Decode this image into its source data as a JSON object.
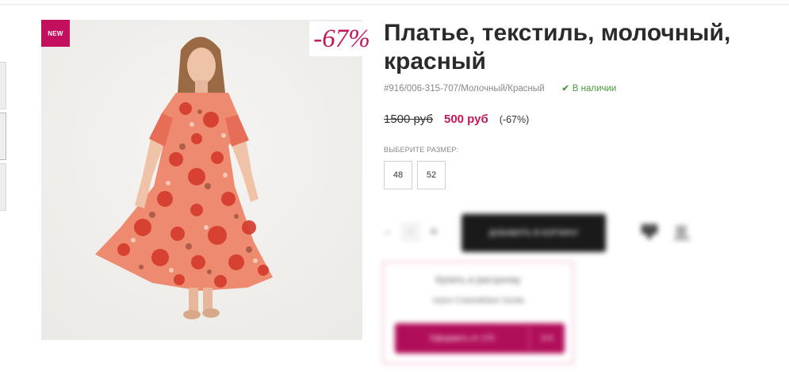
{
  "product": {
    "title": "Платье, текстиль, молочный, красный",
    "sku": "#916/006-315-707/Молочный/Красный",
    "stock_icon": "check-icon",
    "stock_label": "В наличии",
    "badge_new": "NEW",
    "discount_badge": "-67%"
  },
  "pricing": {
    "old_price": "1500 руб",
    "new_price": "500 руб",
    "discount_text": "(-67%)"
  },
  "sizes": {
    "label": "ВЫБЕРИТЕ РАЗМЕР:",
    "options": [
      "48",
      "52"
    ]
  },
  "purchase": {
    "quantity_minus": "-",
    "quantity_value": "1",
    "quantity_plus": "+",
    "add_to_cart_label": "ДОБАВИТЬ В КОРЗИНУ",
    "compare_icon": "compare-icon",
    "favorite_icon": "favorite-icon"
  },
  "credit": {
    "title": "Купить в рассрочку",
    "subtitle": "через Совкомбанк Халва",
    "button_label": "Оформить от 170",
    "button_extra": "0-0"
  },
  "colors": {
    "brand": "#c2185b",
    "badge_new": "#c40f5f",
    "cart_button": "#1a1a1a",
    "credit_button": "#b10e59",
    "in_stock": "#4a9a3c"
  }
}
